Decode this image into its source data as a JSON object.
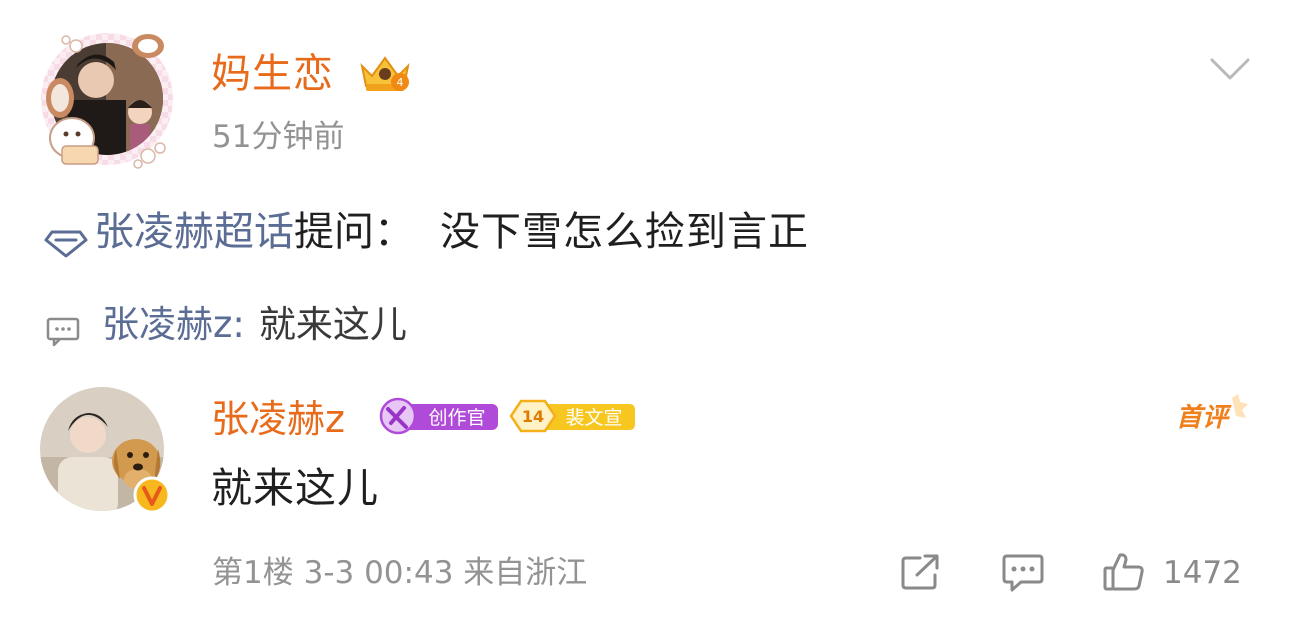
{
  "post": {
    "author": "妈生恋",
    "time": "51分钟前",
    "topic": "张凌赫超话",
    "question_label": "提问：",
    "question_text": "没下雪怎么捡到言正"
  },
  "quote": {
    "user": "张凌赫z:",
    "text": "就来这儿"
  },
  "comment": {
    "user": "张凌赫z",
    "badge_creator": "创作官",
    "badge_fan_level": "14",
    "badge_fan_name": "裴文宣",
    "first_label": "首评",
    "text": "就来这儿",
    "floor": "第1楼",
    "datetime": "3-3 00:43",
    "location": "来自浙江",
    "likes": "1472"
  },
  "colors": {
    "author_orange": "#e86b1b",
    "link_blue": "#5b6d94",
    "meta_gray": "#939393",
    "creator_purple": "#b04ad8",
    "fan_gold": "#f4b000"
  }
}
